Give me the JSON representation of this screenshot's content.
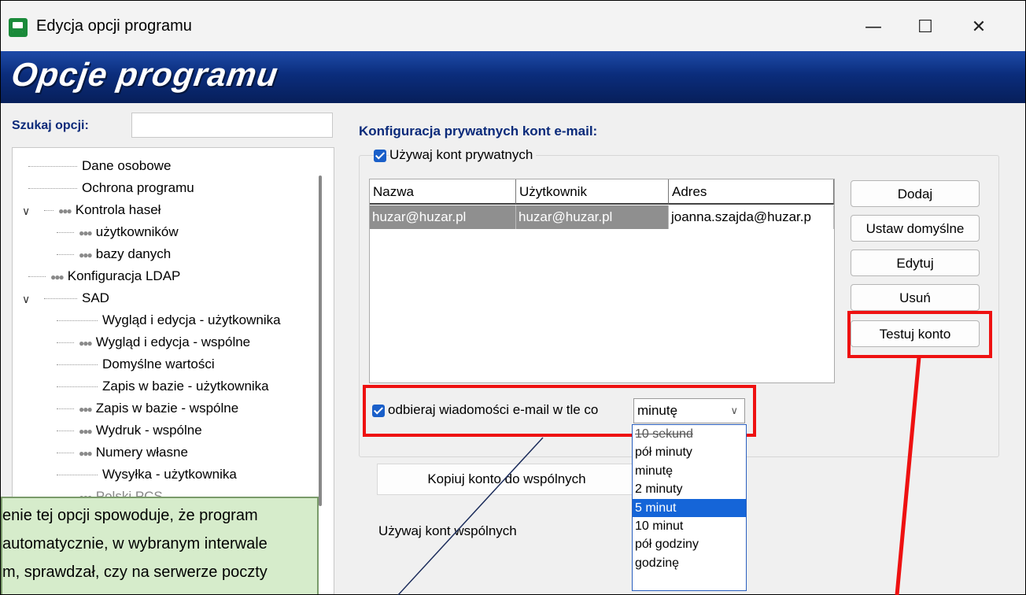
{
  "window": {
    "title": "Edycja opcji programu",
    "minimize_icon": "minimize-icon",
    "maximize_icon": "maximize-icon",
    "close_icon": "close-icon"
  },
  "banner": {
    "title": "Opcje programu"
  },
  "search": {
    "label": "Szukaj opcji:",
    "value": ""
  },
  "tree": [
    {
      "label": "Dane osobowe",
      "icon": ""
    },
    {
      "label": "Ochrona programu",
      "icon": ""
    },
    {
      "label": "Kontrola haseł",
      "icon": "users-icon",
      "expanded": true
    },
    {
      "label": "użytkowników",
      "icon": "users-icon"
    },
    {
      "label": "bazy danych",
      "icon": "users-icon"
    },
    {
      "label": "Konfiguracja LDAP",
      "icon": "users-icon"
    },
    {
      "label": "SAD",
      "icon": "",
      "expanded": true
    },
    {
      "label": "Wygląd i edycja - użytkownika",
      "icon": ""
    },
    {
      "label": "Wygląd i edycja - wspólne",
      "icon": "users-icon"
    },
    {
      "label": "Domyślne wartości",
      "icon": ""
    },
    {
      "label": "Zapis w bazie - użytkownika",
      "icon": ""
    },
    {
      "label": "Zapis w bazie - wspólne",
      "icon": "users-icon"
    },
    {
      "label": "Wydruk - wspólne",
      "icon": "users-icon"
    },
    {
      "label": "Numery własne",
      "icon": "users-icon"
    },
    {
      "label": "Wysyłka - użytkownika",
      "icon": ""
    },
    {
      "label": "Polski PCS",
      "icon": "users-icon"
    }
  ],
  "main": {
    "section_title": "Konfiguracja prywatnych kont e-mail:",
    "use_private_label": "Używaj kont prywatnych",
    "use_private_checked": true,
    "table": {
      "columns": [
        "Nazwa",
        "Użytkownik",
        "Adres"
      ],
      "rows": [
        [
          "huzar@huzar.pl",
          "huzar@huzar.pl",
          "joanna.szajda@huzar.p"
        ]
      ]
    },
    "buttons": {
      "add": "Dodaj",
      "set_default": "Ustaw domyślne",
      "edit": "Edytuj",
      "delete": "Usuń",
      "test": "Testuj konto"
    },
    "receive_label": "odbieraj wiadomości e-mail w tle co",
    "receive_checked": true,
    "interval": {
      "selected": "minutę",
      "options": [
        "10 sekund",
        "pół minuty",
        "minutę",
        "2 minuty",
        "5 minut",
        "10 minut",
        "pół godziny",
        "godzinę"
      ],
      "highlighted": "5 minut"
    },
    "copy_tab": "Kopiuj konto do wspólnych",
    "use_common_label": "Używaj kont wspólnych"
  },
  "callout": {
    "lines": [
      "enie tej opcji spowoduje, że program",
      "automatycznie, w wybranym interwale",
      "m, sprawdzał, czy na serwerze poczty"
    ]
  },
  "colors": {
    "banner": "#0b2d7c",
    "highlight": "#ee1111",
    "selection": "#1565d8",
    "callout_bg": "#d6eccb"
  }
}
